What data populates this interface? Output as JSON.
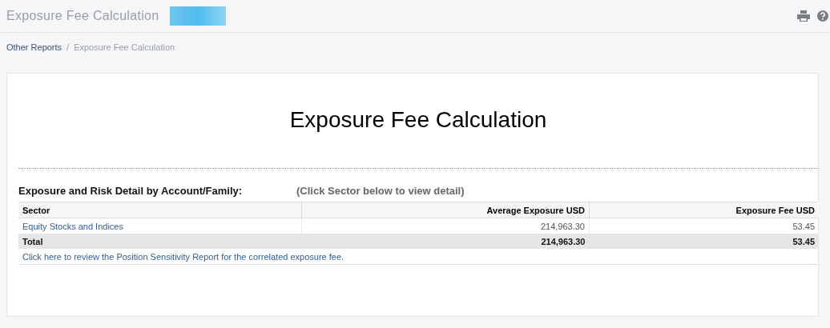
{
  "header": {
    "title": "Exposure Fee Calculation"
  },
  "breadcrumb_separator": "/",
  "breadcrumb": [
    {
      "label": "Other Reports",
      "kind": "link"
    },
    {
      "label": "Exposure Fee Calculation",
      "kind": "current"
    }
  ],
  "report": {
    "title": "Exposure Fee Calculation",
    "section_heading": "Exposure and Risk Detail by Account/Family:",
    "section_hint": "(Click Sector below to view detail)",
    "table": {
      "columns": [
        "Sector",
        "Average Exposure USD",
        "Exposure Fee USD"
      ],
      "rows": [
        {
          "kind": "data",
          "cells": [
            "Equity Stocks and Indices",
            "214,963.30",
            "53.45"
          ]
        },
        {
          "kind": "total",
          "cells": [
            "Total",
            "214,963.30",
            "53.45"
          ]
        }
      ]
    },
    "footer_link": "Click here to review the Position Sensitivity Report for the correlated exposure fee."
  }
}
